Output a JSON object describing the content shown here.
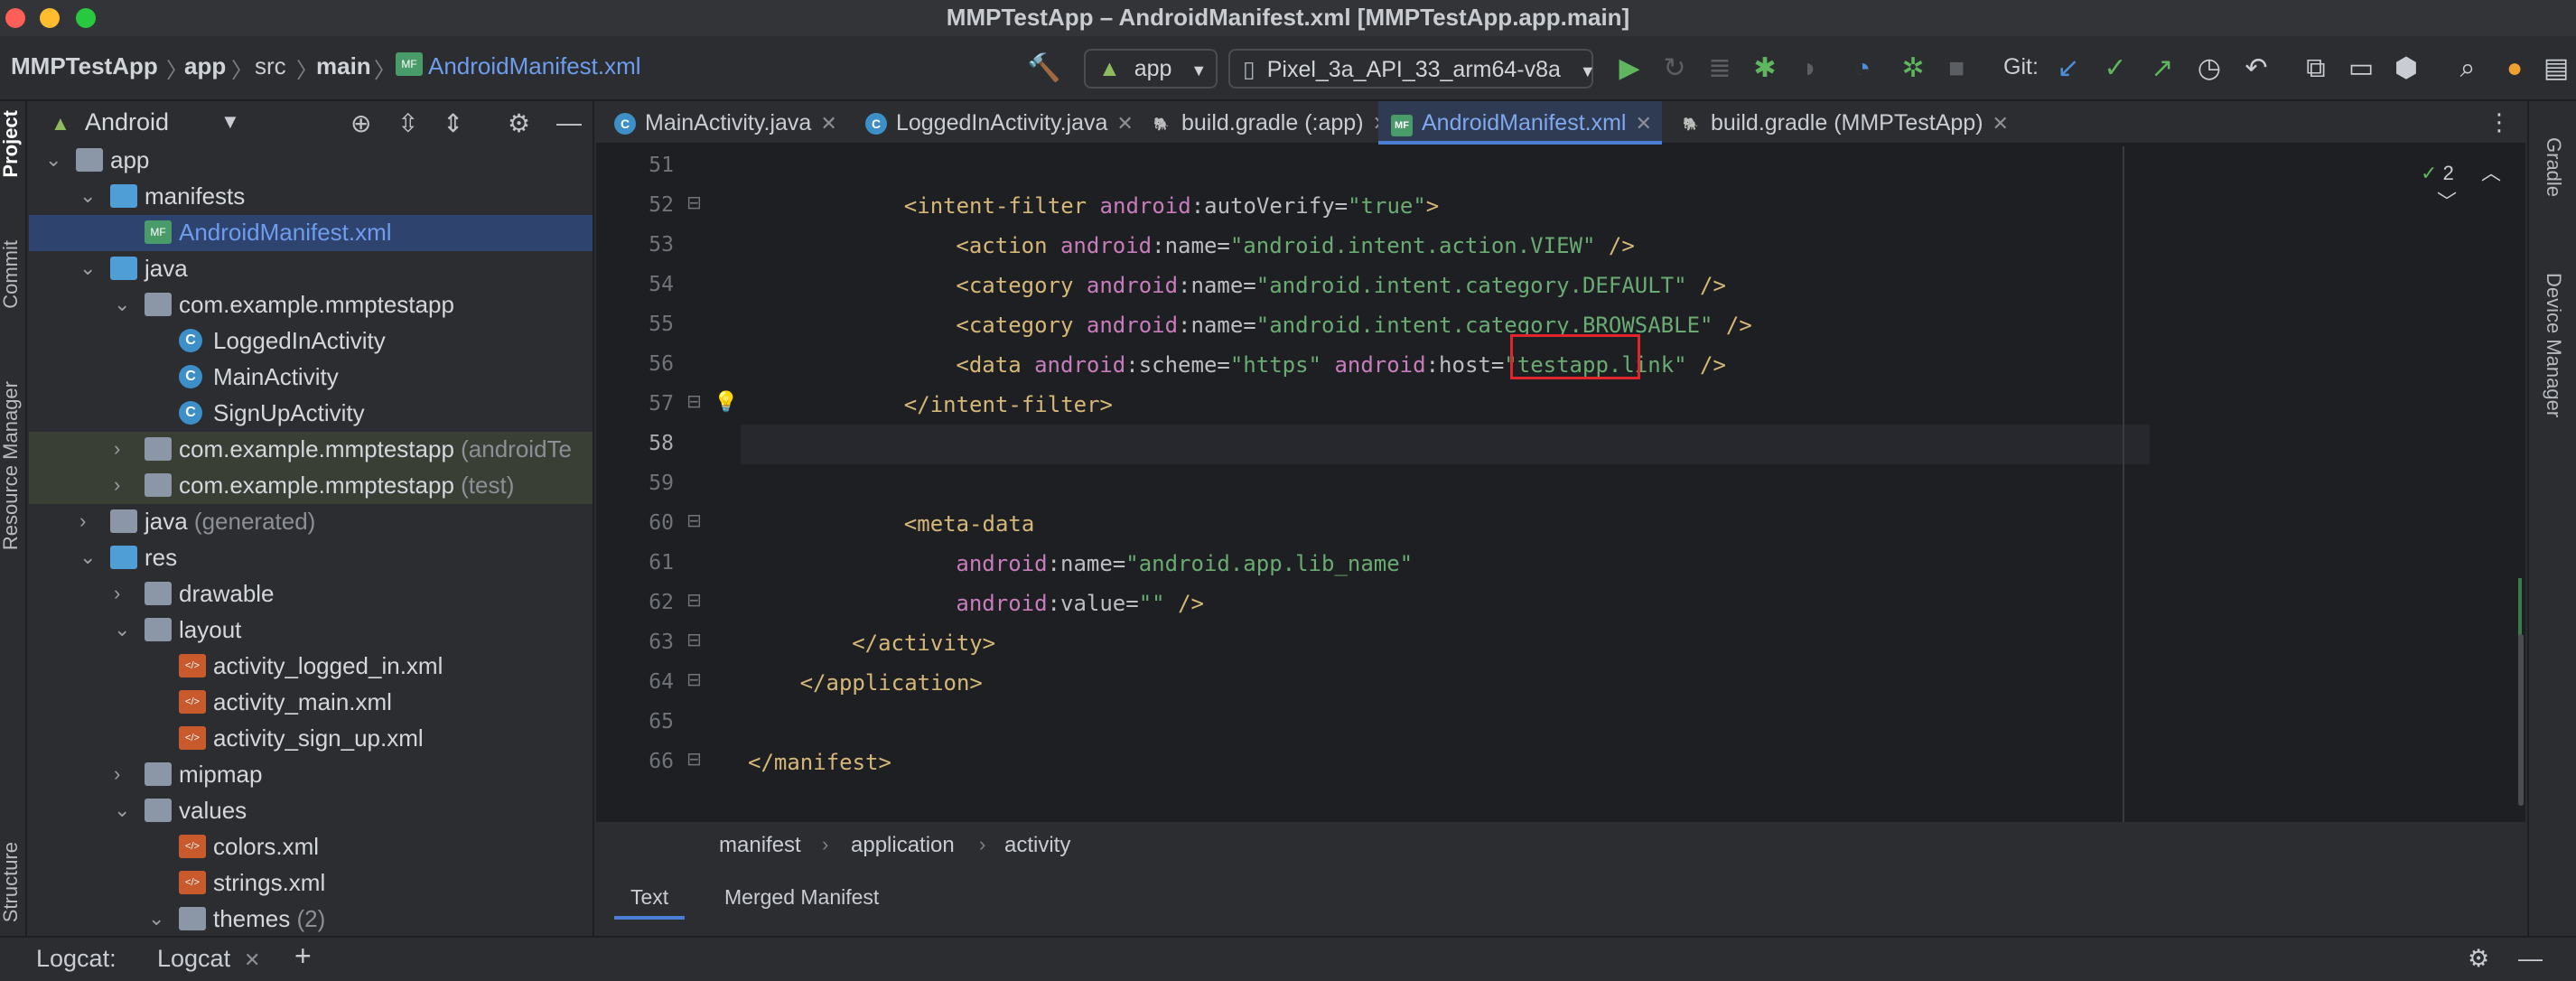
{
  "window": {
    "title": "MMPTestApp – AndroidManifest.xml [MMPTestApp.app.main]"
  },
  "navbar": {
    "breadcrumbs": [
      "MMPTestApp",
      "app",
      "src",
      "main",
      "AndroidManifest.xml"
    ],
    "run_config": "app",
    "device": "Pixel_3a_API_33_arm64-v8a",
    "git_label": "Git:"
  },
  "left_strip": {
    "tabs": [
      "Project",
      "Commit",
      "Resource Manager",
      "Structure"
    ]
  },
  "project_panel": {
    "view": "Android",
    "tree": [
      {
        "label": "app",
        "suffix": "",
        "depth": 0,
        "chevron": "down",
        "icon": "folder-module-icon"
      },
      {
        "label": "manifests",
        "suffix": "",
        "depth": 1,
        "chevron": "down",
        "icon": "folder-icon"
      },
      {
        "label": "AndroidManifest.xml",
        "suffix": "",
        "depth": 2,
        "chevron": "",
        "icon": "manifest-file-icon",
        "selected": true
      },
      {
        "label": "java",
        "suffix": "",
        "depth": 1,
        "chevron": "down",
        "icon": "folder-icon"
      },
      {
        "label": "com.example.mmptestapp",
        "suffix": "",
        "depth": 2,
        "chevron": "down",
        "icon": "package-icon"
      },
      {
        "label": "LoggedInActivity",
        "suffix": "",
        "depth": 3,
        "chevron": "",
        "icon": "class-icon"
      },
      {
        "label": "MainActivity",
        "suffix": "",
        "depth": 3,
        "chevron": "",
        "icon": "class-icon"
      },
      {
        "label": "SignUpActivity",
        "suffix": "",
        "depth": 3,
        "chevron": "",
        "icon": "class-icon"
      },
      {
        "label": "com.example.mmptestapp",
        "suffix": " (androidTe",
        "depth": 2,
        "chevron": "right",
        "icon": "package-icon",
        "muted": true
      },
      {
        "label": "com.example.mmptestapp",
        "suffix": " (test)",
        "depth": 2,
        "chevron": "right",
        "icon": "package-icon",
        "muted": true
      },
      {
        "label": "java",
        "suffix": " (generated)",
        "depth": 1,
        "chevron": "right",
        "icon": "generated-folder-icon"
      },
      {
        "label": "res",
        "suffix": "",
        "depth": 1,
        "chevron": "down",
        "icon": "folder-icon"
      },
      {
        "label": "drawable",
        "suffix": "",
        "depth": 2,
        "chevron": "right",
        "icon": "folder-icon"
      },
      {
        "label": "layout",
        "suffix": "",
        "depth": 2,
        "chevron": "down",
        "icon": "folder-icon"
      },
      {
        "label": "activity_logged_in.xml",
        "suffix": "",
        "depth": 3,
        "chevron": "",
        "icon": "xml-file-icon"
      },
      {
        "label": "activity_main.xml",
        "suffix": "",
        "depth": 3,
        "chevron": "",
        "icon": "xml-file-icon"
      },
      {
        "label": "activity_sign_up.xml",
        "suffix": "",
        "depth": 3,
        "chevron": "",
        "icon": "xml-file-icon"
      },
      {
        "label": "mipmap",
        "suffix": "",
        "depth": 2,
        "chevron": "right",
        "icon": "folder-icon"
      },
      {
        "label": "values",
        "suffix": "",
        "depth": 2,
        "chevron": "down",
        "icon": "folder-icon"
      },
      {
        "label": "colors.xml",
        "suffix": "",
        "depth": 3,
        "chevron": "",
        "icon": "xml-file-icon"
      },
      {
        "label": "strings.xml",
        "suffix": "",
        "depth": 3,
        "chevron": "",
        "icon": "xml-file-icon"
      },
      {
        "label": "themes",
        "suffix": " (2)",
        "depth": 3,
        "chevron": "down",
        "icon": "folder-icon"
      }
    ]
  },
  "editor": {
    "tabs": [
      {
        "label": "MainActivity.java",
        "icon": "class-icon",
        "active": false
      },
      {
        "label": "LoggedInActivity.java",
        "icon": "class-icon",
        "active": false
      },
      {
        "label": "build.gradle (:app)",
        "icon": "gradle-icon",
        "active": false
      },
      {
        "label": "AndroidManifest.xml",
        "icon": "manifest-file-icon",
        "active": true
      },
      {
        "label": "build.gradle (MMPTestApp)",
        "icon": "gradle-icon",
        "active": false
      }
    ],
    "inspection_count": "2",
    "lines": [
      {
        "n": "51",
        "indent": 0,
        "parts": []
      },
      {
        "n": "52",
        "indent": 12,
        "parts": [
          [
            "tag",
            "<intent-filter "
          ],
          [
            "ns",
            "android"
          ],
          [
            "attr",
            ":autoVerify="
          ],
          [
            "val",
            "\"true\""
          ],
          [
            "tag",
            ">"
          ]
        ]
      },
      {
        "n": "53",
        "indent": 16,
        "parts": [
          [
            "tag",
            "<action "
          ],
          [
            "ns",
            "android"
          ],
          [
            "attr",
            ":name="
          ],
          [
            "val",
            "\"android.intent.action.VIEW\""
          ],
          [
            "tag",
            " />"
          ]
        ]
      },
      {
        "n": "54",
        "indent": 16,
        "parts": [
          [
            "tag",
            "<category "
          ],
          [
            "ns",
            "android"
          ],
          [
            "attr",
            ":name="
          ],
          [
            "val",
            "\"android.intent.category.DEFAULT\""
          ],
          [
            "tag",
            " />"
          ]
        ]
      },
      {
        "n": "55",
        "indent": 16,
        "parts": [
          [
            "tag",
            "<category "
          ],
          [
            "ns",
            "android"
          ],
          [
            "attr",
            ":name="
          ],
          [
            "val",
            "\"android.intent.category.BROWSABLE\""
          ],
          [
            "tag",
            " />"
          ]
        ]
      },
      {
        "n": "56",
        "indent": 16,
        "parts": [
          [
            "tag",
            "<data "
          ],
          [
            "ns",
            "android"
          ],
          [
            "attr",
            ":scheme="
          ],
          [
            "val",
            "\"https\" "
          ],
          [
            "ns",
            "android"
          ],
          [
            "attr",
            ":host="
          ],
          [
            "val",
            "\"testapp.link\" "
          ],
          [
            "tag",
            "/>"
          ]
        ]
      },
      {
        "n": "57",
        "indent": 12,
        "parts": [
          [
            "tag",
            "</intent-filter>"
          ]
        ]
      },
      {
        "n": "58",
        "indent": 0,
        "parts": [],
        "current": true
      },
      {
        "n": "59",
        "indent": 0,
        "parts": []
      },
      {
        "n": "60",
        "indent": 12,
        "parts": [
          [
            "tag",
            "<meta-data"
          ]
        ]
      },
      {
        "n": "61",
        "indent": 16,
        "parts": [
          [
            "ns",
            "android"
          ],
          [
            "attr",
            ":name="
          ],
          [
            "val",
            "\"android.app.lib_name\""
          ]
        ]
      },
      {
        "n": "62",
        "indent": 16,
        "parts": [
          [
            "ns",
            "android"
          ],
          [
            "attr",
            ":value="
          ],
          [
            "val",
            "\"\" "
          ],
          [
            "tag",
            "/>"
          ]
        ]
      },
      {
        "n": "63",
        "indent": 8,
        "parts": [
          [
            "tag",
            "</activity>"
          ]
        ]
      },
      {
        "n": "64",
        "indent": 4,
        "parts": [
          [
            "tag",
            "</application>"
          ]
        ]
      },
      {
        "n": "65",
        "indent": 0,
        "parts": []
      },
      {
        "n": "66",
        "indent": 0,
        "parts": [
          [
            "tag",
            "</manifest>"
          ]
        ]
      }
    ],
    "breadcrumbs": [
      "manifest",
      "application",
      "activity"
    ],
    "view_tabs": [
      "Text",
      "Merged Manifest"
    ]
  },
  "right_strip": {
    "tabs": [
      "Gradle",
      "Device Manager"
    ]
  },
  "bottom_bar": {
    "label": "Logcat:",
    "tab": "Logcat"
  }
}
